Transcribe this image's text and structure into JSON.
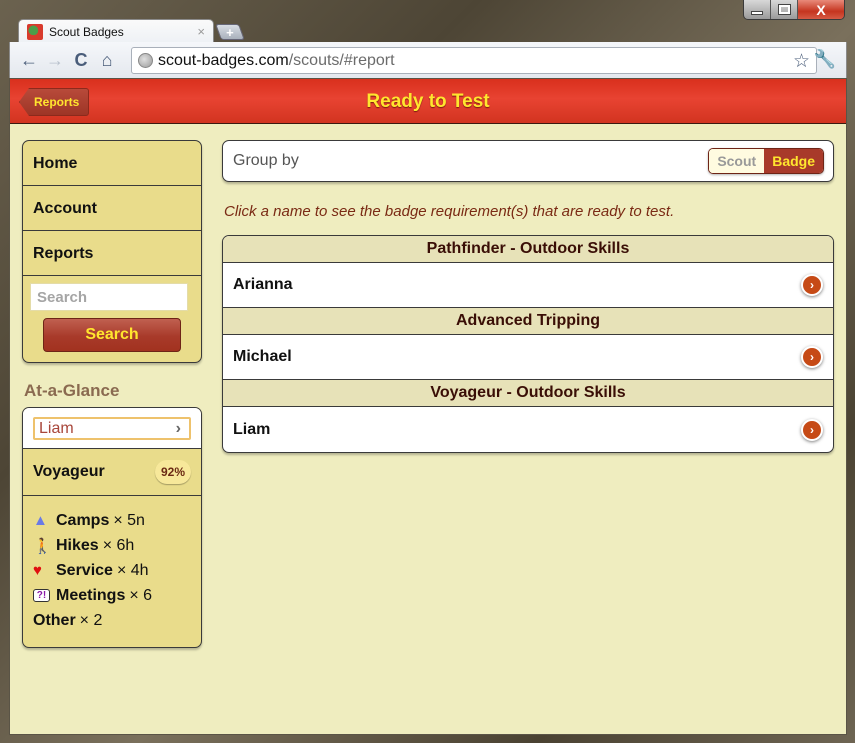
{
  "browser": {
    "tab_title": "Scout Badges",
    "tab_close": "×",
    "new_tab": "+",
    "url_host": "scout-badges.com",
    "url_path": "/scouts/#report",
    "icons": {
      "back": "←",
      "forward": "→",
      "reload": "C",
      "home": "⌂",
      "star": "☆",
      "wrench": "🔧"
    },
    "window_controls": {
      "minimize": "",
      "maximize": "",
      "close": "X"
    }
  },
  "header": {
    "back_label": "Reports",
    "title": "Ready to Test"
  },
  "sidebar": {
    "nav": [
      {
        "label": "Home"
      },
      {
        "label": "Account"
      },
      {
        "label": "Reports"
      }
    ],
    "search": {
      "placeholder": "Search",
      "value": "",
      "button_label": "Search"
    },
    "at_a_glance": {
      "title": "At-a-Glance",
      "selected_scout": "Liam",
      "chevron": "›",
      "badge_name": "Voyageur",
      "badge_progress": "92%",
      "stats": [
        {
          "icon": "tent-icon",
          "glyph": "▲",
          "label": "Camps",
          "value": "× 5n"
        },
        {
          "icon": "hiker-icon",
          "glyph": "🚶",
          "label": "Hikes",
          "value": "× 6h"
        },
        {
          "icon": "heart-icon",
          "glyph": "♥",
          "label": "Service",
          "value": "× 4h"
        },
        {
          "icon": "speech-bubble-icon",
          "glyph": "?!",
          "label": "Meetings",
          "value": "× 6"
        },
        {
          "icon": "",
          "glyph": "",
          "label": "Other",
          "value": "× 2"
        }
      ]
    }
  },
  "main": {
    "group_by": {
      "label": "Group by",
      "options": [
        "Scout",
        "Badge"
      ],
      "selected": "Badge"
    },
    "hint": "Click a name to see the badge requirement(s) that are ready to test.",
    "groups": [
      {
        "badge": "Pathfinder - Outdoor Skills",
        "scouts": [
          "Arianna"
        ]
      },
      {
        "badge": "Advanced Tripping",
        "scouts": [
          "Michael"
        ]
      },
      {
        "badge": "Voyageur - Outdoor Skills",
        "scouts": [
          "Liam"
        ]
      }
    ],
    "row_arrow": "›"
  },
  "colors": {
    "header_red": "#e03a28",
    "accent_yellow": "#ffe62e",
    "panel_yellow": "#e9dc8b",
    "page_bg": "#efedbf",
    "button_red": "#a83a2a",
    "go_orange": "#c64a16"
  }
}
